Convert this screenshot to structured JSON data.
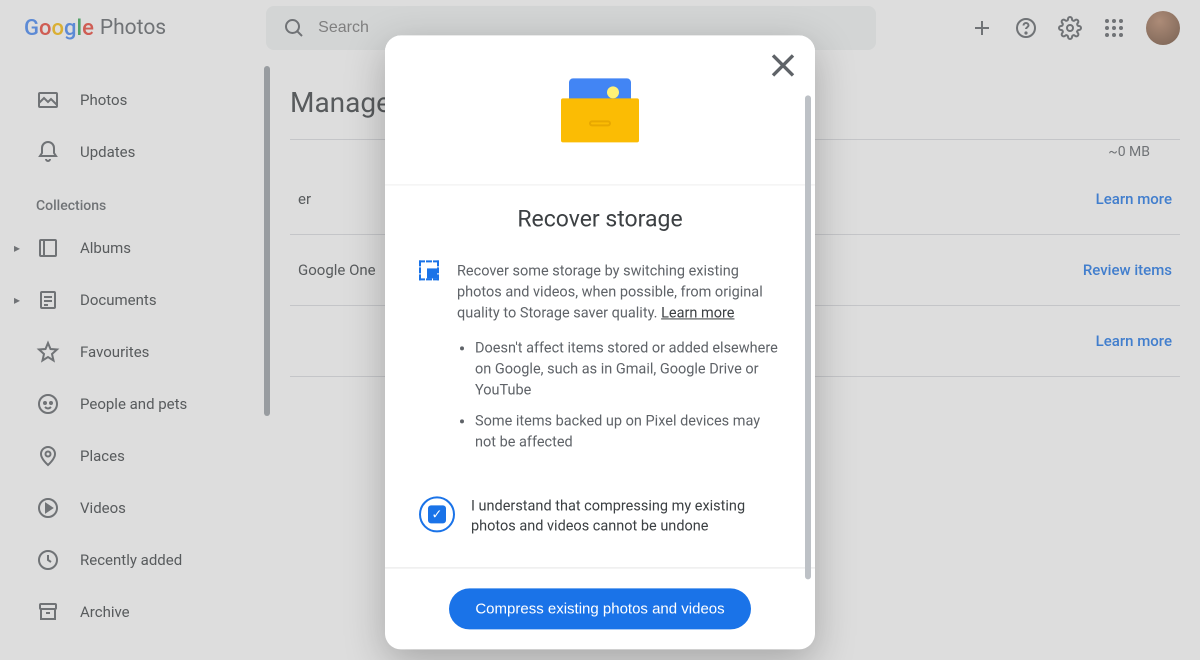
{
  "header": {
    "logo_prefix": "Google",
    "logo_suffix": "Photos",
    "search_placeholder": "Search"
  },
  "sidebar": {
    "primary": [
      {
        "label": "Photos",
        "icon": "photo"
      },
      {
        "label": "Updates",
        "icon": "bell"
      }
    ],
    "collections_heading": "Collections",
    "collections": [
      {
        "label": "Albums",
        "icon": "album",
        "expandable": true
      },
      {
        "label": "Documents",
        "icon": "doc",
        "expandable": true
      },
      {
        "label": "Favourites",
        "icon": "star"
      },
      {
        "label": "People and pets",
        "icon": "face"
      },
      {
        "label": "Places",
        "icon": "pin"
      },
      {
        "label": "Videos",
        "icon": "play"
      },
      {
        "label": "Recently added",
        "icon": "clock"
      },
      {
        "label": "Archive",
        "icon": "archive"
      }
    ]
  },
  "main": {
    "title": "Manage",
    "storage_size": "~0 MB",
    "rows": [
      {
        "label_suffix": "er",
        "action": "Learn more"
      },
      {
        "label_suffix": "Google One",
        "action": "Review items"
      },
      {
        "label_suffix": "",
        "action": "Learn more"
      }
    ]
  },
  "modal": {
    "title": "Recover storage",
    "description": "Recover some storage by switching existing photos and videos, when possible, from original quality to Storage saver quality.",
    "learn_more": "Learn more",
    "bullets": [
      "Doesn't affect items stored or added elsewhere on Google, such as in Gmail, Google Drive or YouTube",
      "Some items backed up on Pixel devices may not be affected"
    ],
    "confirm_text": "I understand that compressing my existing photos and videos cannot be undone",
    "confirm_checked": true,
    "primary_action": "Compress existing photos and videos"
  }
}
